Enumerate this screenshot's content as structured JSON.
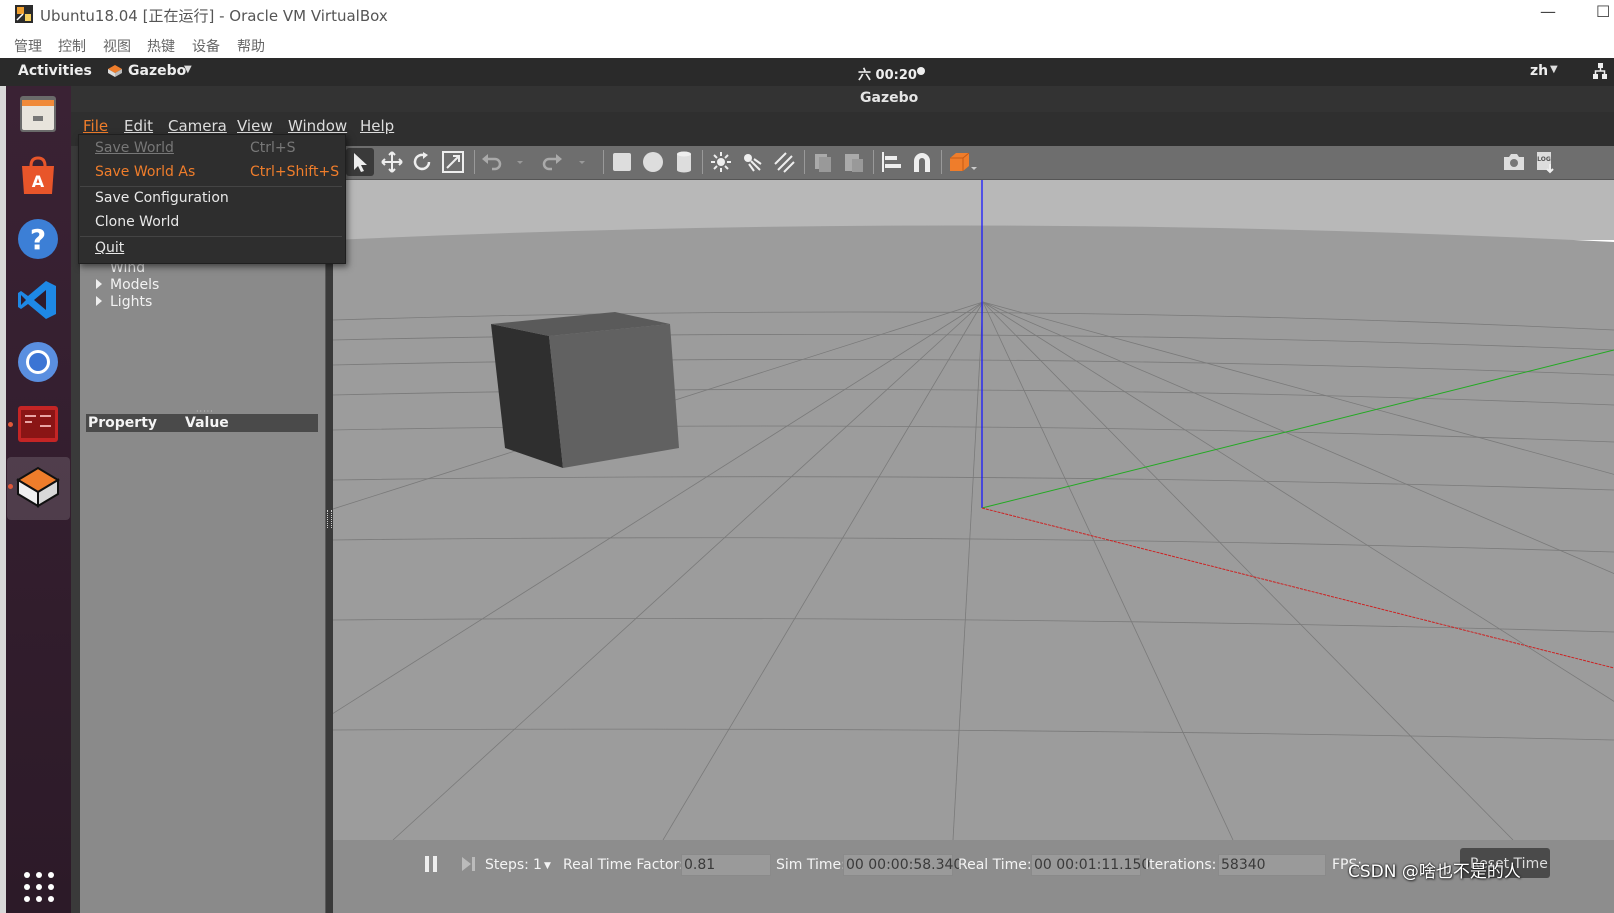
{
  "vbox": {
    "title": "Ubuntu18.04 [正在运行] - Oracle VM VirtualBox",
    "menu": [
      "管理",
      "控制",
      "视图",
      "热键",
      "设备",
      "帮助"
    ]
  },
  "ubuntu": {
    "activities": "Activities",
    "app_name": "Gazebo",
    "clock": "六 00:20",
    "lang": "zh",
    "dock": [
      {
        "name": "files-icon"
      },
      {
        "name": "software-center-icon"
      },
      {
        "name": "help-icon"
      },
      {
        "name": "vscode-icon"
      },
      {
        "name": "chromium-icon"
      },
      {
        "name": "terminal-icon"
      },
      {
        "name": "gazebo-icon"
      }
    ]
  },
  "gazebo": {
    "window_title": "Gazebo",
    "menus": [
      "File",
      "Edit",
      "Camera",
      "View",
      "Window",
      "Help"
    ],
    "file_menu": {
      "save_world": "Save World",
      "save_world_shortcut": "Ctrl+S",
      "save_world_as": "Save World As",
      "save_world_as_shortcut": "Ctrl+Shift+S",
      "save_configuration": "Save Configuration",
      "clone_world": "Clone World",
      "quit": "Quit"
    },
    "tree": {
      "wind": "Wind",
      "models": "Models",
      "lights": "Lights"
    },
    "property_table": {
      "property": "Property",
      "value": "Value"
    },
    "bottom": {
      "steps_label": "Steps:",
      "steps_value": "1",
      "rtf_label": "Real Time Factor:",
      "rtf_value": "0.81",
      "sim_time_label": "Sim Time:",
      "sim_time_value": "00 00:00:58.340",
      "real_time_label": "Real Time:",
      "real_time_value": "00 00:01:11.150",
      "iterations_label": "Iterations:",
      "iterations_value": "58340",
      "fps_label": "FPS:",
      "reset_label": "Reset Time"
    }
  },
  "watermark": "CSDN @啥也不是的人",
  "colors": {
    "accent_orange": "#ef7d2b",
    "ground": "#9a9a9a",
    "sky": "#b9b9b9"
  }
}
